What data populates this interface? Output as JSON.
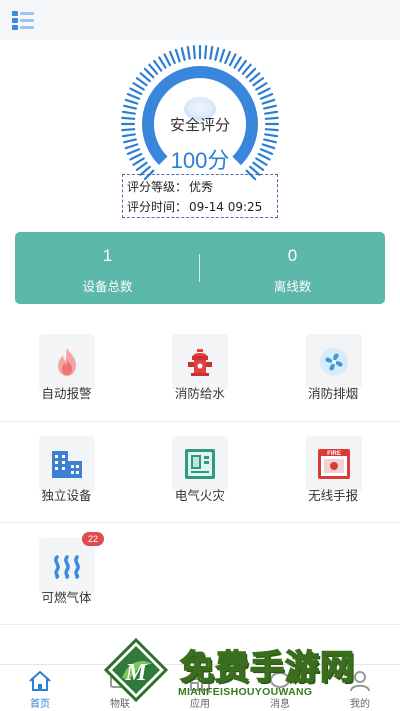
{
  "header": {
    "menu_icon": "menu-list-icon"
  },
  "safety": {
    "label": "安全评分",
    "score": "100分",
    "score_value": 100,
    "grade_label": "评分等级：",
    "grade_value": "优秀",
    "time_label": "评分时间：",
    "time_value": "09-14 09:25",
    "accent": "#2d7fd3"
  },
  "stats": [
    {
      "value": "1",
      "label": "设备总数"
    },
    {
      "value": "0",
      "label": "离线数"
    }
  ],
  "stats_color": "#5cb8a9",
  "modules": [
    {
      "label": "自动报警",
      "icon": "fire-icon"
    },
    {
      "label": "消防给水",
      "icon": "hydrant-icon"
    },
    {
      "label": "消防排烟",
      "icon": "fan-icon"
    },
    {
      "label": "独立设备",
      "icon": "building-icon"
    },
    {
      "label": "电气火灾",
      "icon": "electric-panel-icon"
    },
    {
      "label": "无线手报",
      "icon": "fire-alarm-icon",
      "icon_text": "FIRE"
    },
    {
      "label": "可燃气体",
      "icon": "gas-icon",
      "badge": "22"
    }
  ],
  "tabbar": [
    {
      "label": "首页",
      "icon": "home-icon",
      "active": true
    },
    {
      "label": "物联",
      "icon": "iot-icon"
    },
    {
      "label": "应用",
      "icon": "apps-icon"
    },
    {
      "label": "消息",
      "icon": "message-icon"
    },
    {
      "label": "我的",
      "icon": "user-icon"
    }
  ],
  "watermark": {
    "title": "免费手游网",
    "subtitle": "MIANFEISHOUYOUWANG",
    "logo_letter": "M"
  }
}
